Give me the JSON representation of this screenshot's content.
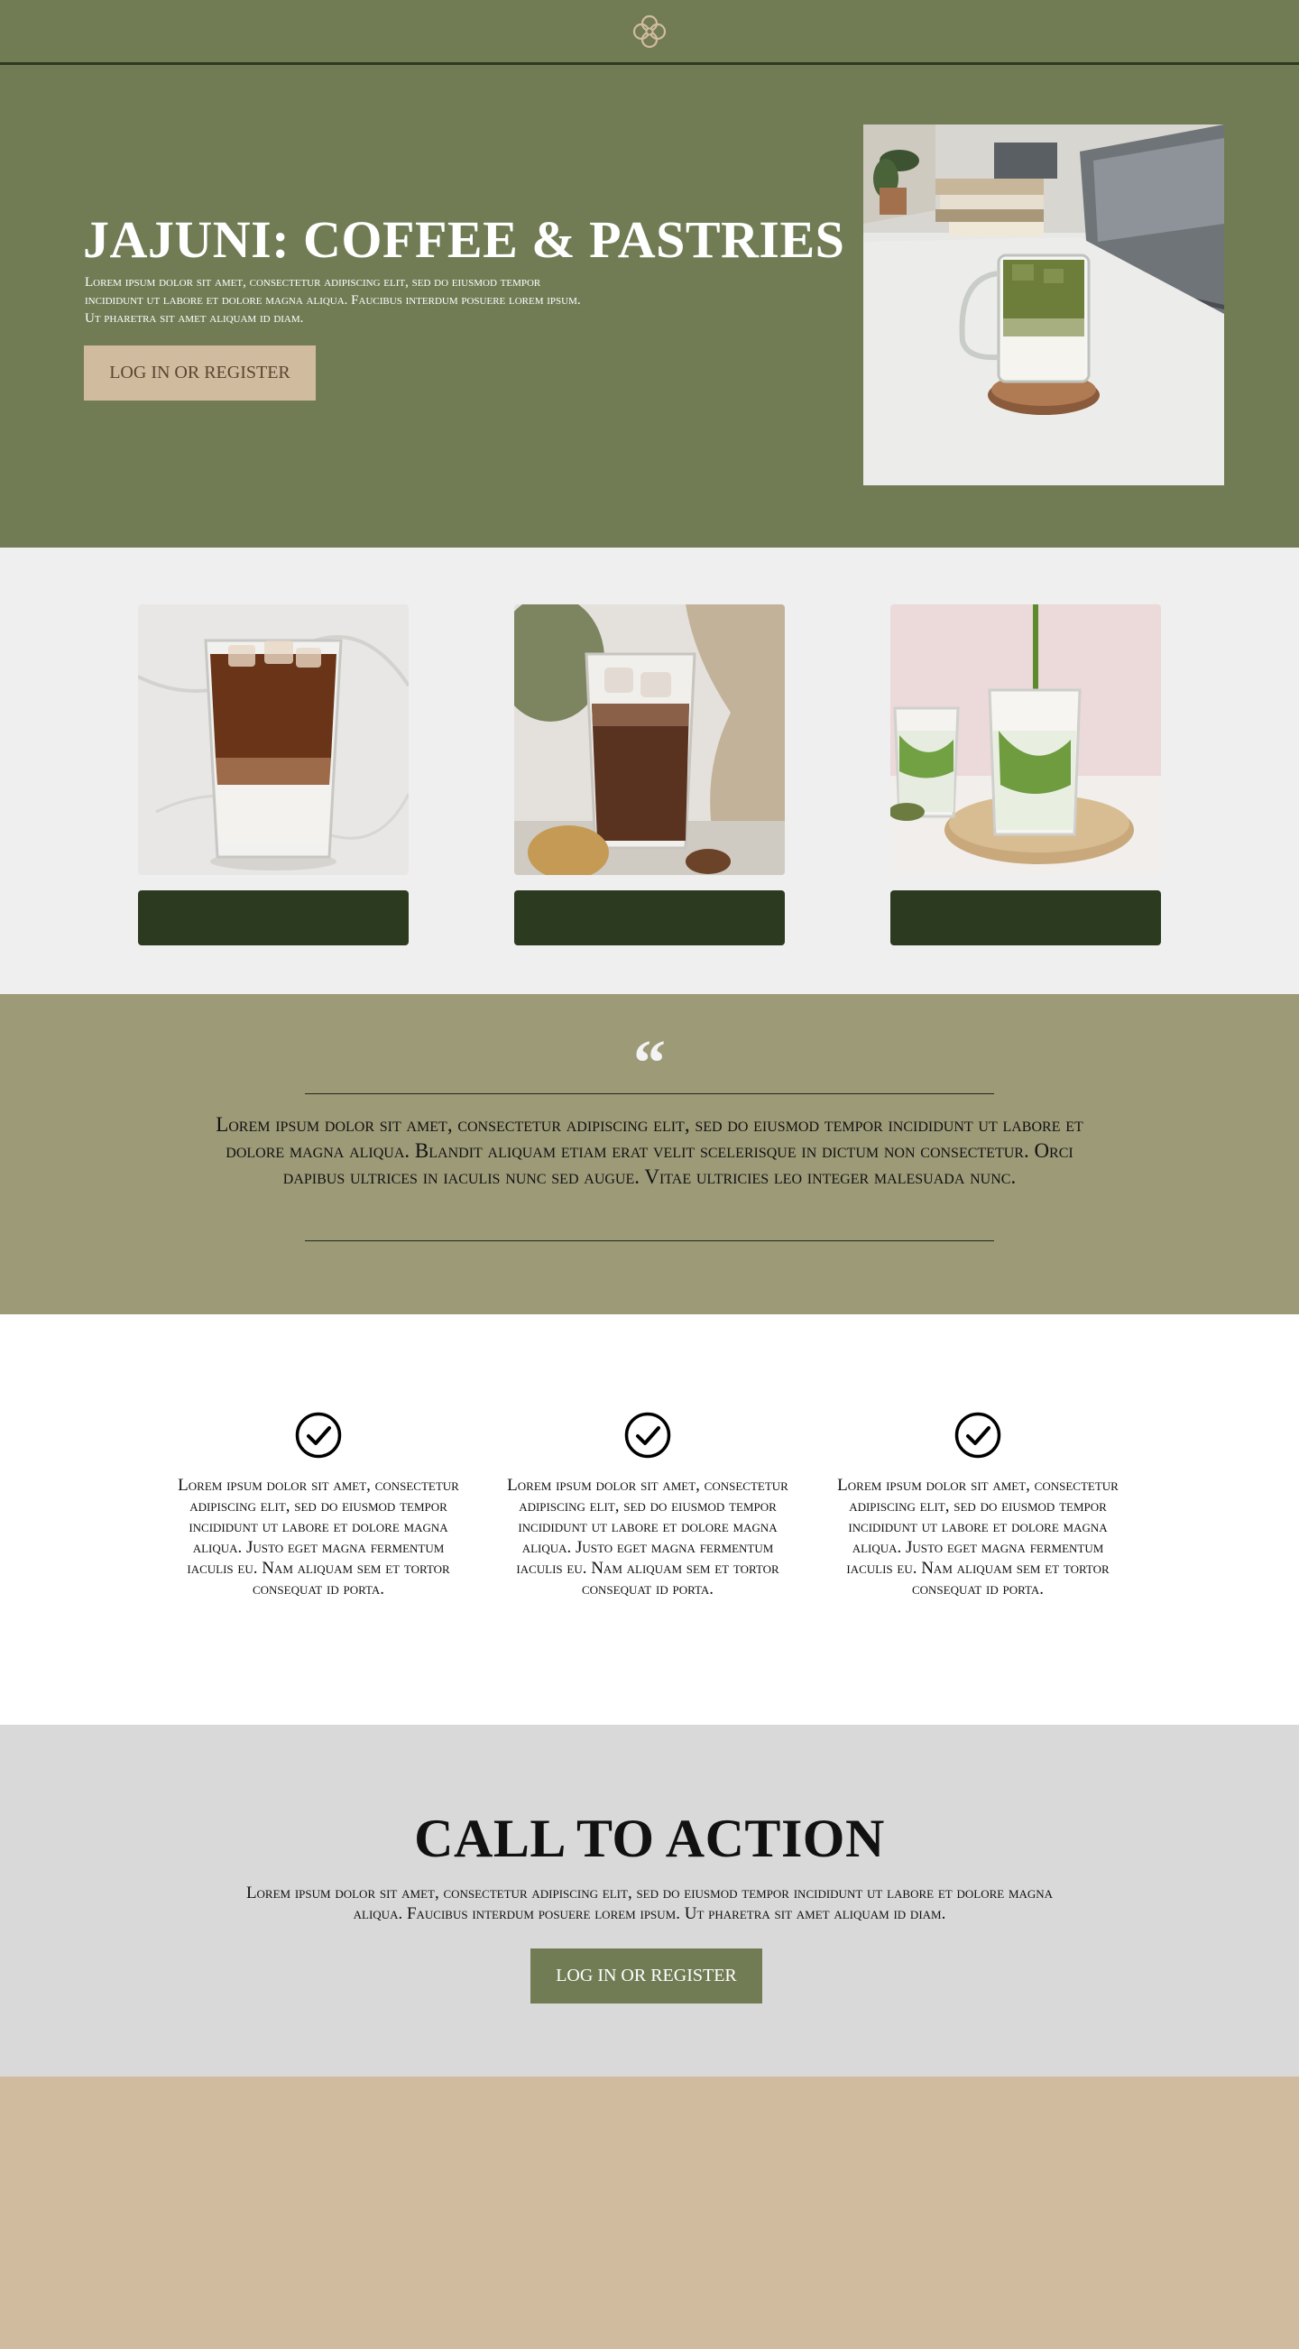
{
  "header": {
    "logo_icon": "quatrefoil-flower-icon"
  },
  "hero": {
    "title": "JAJUNI: COFFEE & PASTRIES",
    "subtitle": "Lorem ipsum dolor sit amet, consectetur adipiscing elit, sed do eiusmod tempor incididunt ut labore et dolore magna aliqua. Faucibus interdum posuere lorem ipsum. Ut pharetra sit amet aliquam id diam.",
    "button_label": "Log in or register",
    "photo": "iced-matcha-latte-on-desk-photo"
  },
  "products": [
    {
      "photo": "iced-coffee-latte-photo",
      "button_label": ""
    },
    {
      "photo": "iced-mocha-drink-photo",
      "button_label": ""
    },
    {
      "photo": "matcha-pour-photo",
      "button_label": ""
    }
  ],
  "quote": {
    "mark": "“",
    "text": "Lorem ipsum dolor sit amet, consectetur adipiscing elit, sed do eiusmod tempor incididunt ut labore et dolore magna aliqua. Blandit aliquam etiam erat velit scelerisque in dictum non consectetur. Orci dapibus ultrices in iaculis nunc sed augue. Vitae ultricies leo integer malesuada nunc."
  },
  "features": [
    {
      "icon": "check-circle-icon",
      "text": "Lorem ipsum dolor sit amet, consectetur adipiscing elit, sed do eiusmod tempor incididunt ut labore et dolore magna aliqua. Justo eget magna fermentum iaculis eu. Nam aliquam sem et tortor consequat id porta."
    },
    {
      "icon": "check-circle-icon",
      "text": "Lorem ipsum dolor sit amet, consectetur adipiscing elit, sed do eiusmod tempor incididunt ut labore et dolore magna aliqua. Justo eget magna fermentum iaculis eu. Nam aliquam sem et tortor consequat id porta."
    },
    {
      "icon": "check-circle-icon",
      "text": "Lorem ipsum dolor sit amet, consectetur adipiscing elit, sed do eiusmod tempor incididunt ut labore et dolore magna aliqua. Justo eget magna fermentum iaculis eu. Nam aliquam sem et tortor consequat id porta."
    }
  ],
  "cta": {
    "title": "CALL TO ACTION",
    "text": "Lorem ipsum dolor sit amet, consectetur adipiscing elit, sed do eiusmod tempor incididunt ut labore et dolore magna aliqua. Faucibus interdum posuere lorem ipsum. Ut pharetra sit amet aliquam id diam.",
    "button_label": "Log in or register"
  },
  "colors": {
    "olive": "#717c55",
    "dark_green": "#2c3a20",
    "tan": "#d1bb9f",
    "khaki": "#9d9a78",
    "light_gray": "#efefef",
    "cta_gray": "#d9d9d9"
  }
}
